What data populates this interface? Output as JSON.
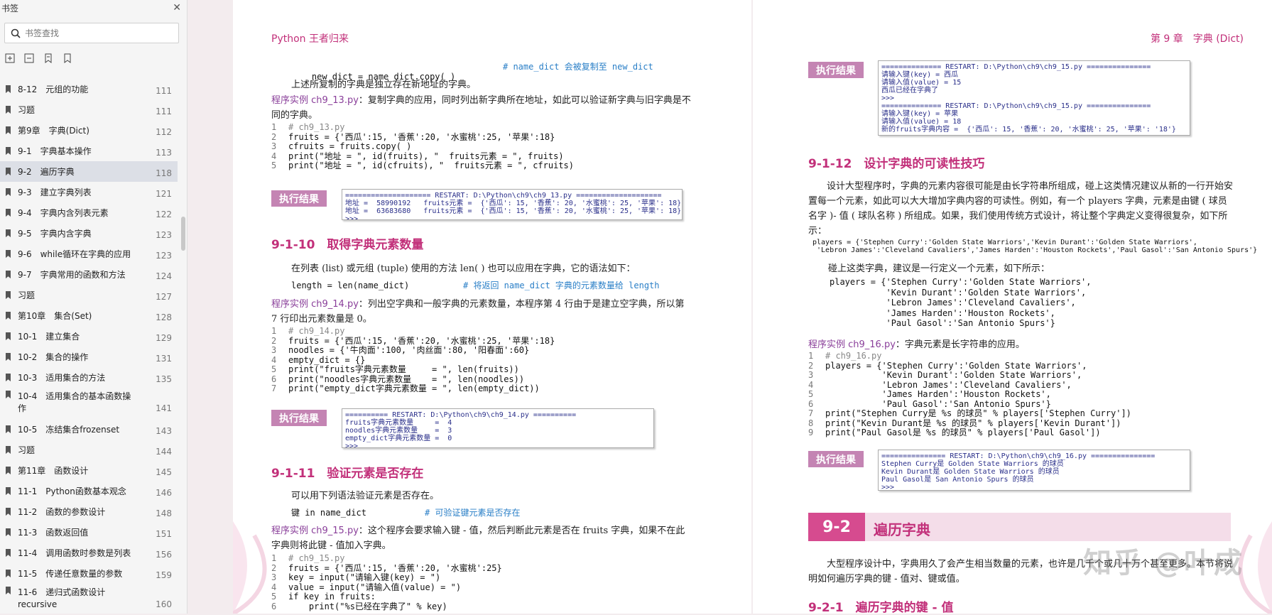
{
  "sidebar": {
    "title": "书签",
    "close_icon": "close-icon",
    "search_placeholder": "书签查找",
    "items": [
      {
        "label": "8-12　元组的功能",
        "page": "111"
      },
      {
        "label": "习题",
        "page": "111"
      },
      {
        "label": "第9章　字典(Dict)",
        "page": "112"
      },
      {
        "label": "9-1　字典基本操作",
        "page": "113"
      },
      {
        "label": "9-2　遍历字典",
        "page": "118"
      },
      {
        "label": "9-3　建立字典列表",
        "page": "121"
      },
      {
        "label": "9-4　字典内含列表元素",
        "page": "122"
      },
      {
        "label": "9-5　字典内含字典",
        "page": "123"
      },
      {
        "label": "9-6　while循环在字典的应用",
        "page": "123"
      },
      {
        "label": "9-7　字典常用的函数和方法",
        "page": "124"
      },
      {
        "label": "习题",
        "page": "127"
      },
      {
        "label": "第10章　集合(Set)",
        "page": "128"
      },
      {
        "label": "10-1　建立集合",
        "page": "129"
      },
      {
        "label": "10-2　集合的操作",
        "page": "131"
      },
      {
        "label": "10-3　适用集合的方法",
        "page": "135"
      },
      {
        "label": "10-4　适用集合的基本函数操作",
        "page": "141"
      },
      {
        "label": "10-5　冻结集合frozenset",
        "page": "143"
      },
      {
        "label": "习题",
        "page": "144"
      },
      {
        "label": "第11章　函数设计",
        "page": "145"
      },
      {
        "label": "11-1　Python函数基本观念",
        "page": "146"
      },
      {
        "label": "11-2　函数的参数设计",
        "page": "148"
      },
      {
        "label": "11-3　函数返回值",
        "page": "151"
      },
      {
        "label": "11-4　调用函数时参数是列表",
        "page": "156"
      },
      {
        "label": "11-5　传递任意数量的参数",
        "page": "159"
      },
      {
        "label": "11-6　递归式函数设计recursive",
        "page": "160"
      }
    ]
  },
  "left": {
    "runhead": "Python 王者归来",
    "copy_line": "new_dict = name_dict.copy( )",
    "copy_comment": "# name_dict 会被复制至 new_dict",
    "p1": "上述所复制的字典是独立存在新地址的字典。",
    "ex13_label": "程序实例 ch9_13.py",
    "ex13_text": "：复制字典的应用，同时列出新字典所在地址，如此可以验证新字典与旧字典是不同的字典。",
    "ex13_code": [
      "# ch9_13.py",
      "fruits = {'西瓜':15, '香蕉':20, '水蜜桃':25, '苹果':18}",
      "cfruits = fruits.copy( )",
      "print(\"地址 = \", id(fruits), \"  fruits元素 = \", fruits)",
      "print(\"地址 = \", id(cfruits), \"  fruits元素 = \", cfruits)"
    ],
    "result_label": "执行结果",
    "ex13_out": "==================== RESTART: D:\\Python\\ch9\\ch9_13.py ====================\n地址 =  58990192   fruits元素 =  {'西瓜': 15, '香蕉': 20, '水蜜桃': 25, '苹果': 18}\n地址 =  63683680   fruits元素 =  {'西瓜': 15, '香蕉': 20, '水蜜桃': 25, '苹果': 18}\n>>>",
    "h_910": "9-1-10　取得字典元素数量",
    "p_len": "在列表 (list) 或元组 (tuple) 使用的方法 len( ) 也可以应用在字典，它的语法如下：",
    "len_line": "length = len(name_dict)",
    "len_comment": "# 将返回 name_dict 字典的元素数量给 length",
    "ex14_label": "程序实例 ch9_14.py",
    "ex14_text": "：列出空字典和一般字典的元素数量，本程序第 4 行由于是建立空字典，所以第 7 行印出元素数量是 0。",
    "ex14_code": [
      "# ch9_14.py",
      "fruits = {'西瓜':15, '香蕉':20, '水蜜桃':25, '苹果':18}",
      "noodles = {'牛肉面':100, '肉丝面':80, '阳春面':60}",
      "empty_dict = {}",
      "print(\"fruits字典元素数量     = \", len(fruits))",
      "print(\"noodles字典元素数量    = \", len(noodles))",
      "print(\"empty_dict字典元素数量 = \", len(empty_dict))"
    ],
    "ex14_out": "========== RESTART: D:\\Python\\ch9\\ch9_14.py ==========\nfruits字典元素数量     =  4\nnoodles字典元素数量    =  3\nempty_dict字典元素数量 =  0\n>>>",
    "h_911": "9-1-11　验证元素是否存在",
    "p_in": "可以用下列语法验证元素是否存在。",
    "in_line": "键 in name_dict",
    "in_comment": "# 可验证键元素是否存在",
    "ex15_label": "程序实例 ch9_15.py",
    "ex15_text": "：这个程序会要求输入键 - 值，然后判断此元素是否在 fruits 字典，如果不在此字典则将此键 - 值加入字典。",
    "ex15_code": [
      "# ch9_15.py",
      "fruits = {'西瓜':15, '香蕉':20, '水蜜桃':25}",
      "key = input(\"请输入键(key) = \")",
      "value = input(\"请输入值(value) = \")",
      "if key in fruits:",
      "    print(\"%s已经在字典了\" % key)"
    ]
  },
  "right": {
    "runhead": "第 9 章　字典 (Dict)",
    "result_label": "执行结果",
    "ex15_out": "============== RESTART: D:\\Python\\ch9\\ch9_15.py ===============\n请输入键(key) = 西瓜\n请输入值(value) = 15\n西瓜已经在字典了\n>>>\n============== RESTART: D:\\Python\\ch9\\ch9_15.py ===============\n请输入键(key) = 苹果\n请输入值(value) = 18\n新的fruits字典内容 =  {'西瓜': 15, '香蕉': 20, '水蜜桃': 25, '苹果': '18'}\n>>>",
    "h_912": "9-1-12　设计字典的可读性技巧",
    "p_912": "设计大型程序时，字典的元素内容很可能是由长字符串所组成，碰上这类情况建议从新的一行开始安置每一个元素，如此可以大大增加字典内容的可读性。例如，有一个 players 字典，元素是由键 ( 球员名字 )- 值 ( 球队名称 ) 所组成。如果，我们使用传统方式设计，将让整个字典定义变得很复杂，如下所示：",
    "players_long": "players = {'Stephen Curry':'Golden State Warriors','Kevin Durant':'Golden State Warriors',\n 'Lebron James':'Cleveland Cavaliers','James Harden':'Houston Rockets','Paul Gasol':'San Antonio Spurs'}",
    "p_multi": "碰上这类字典，建议是一行定义一个元素，如下所示：",
    "players_multi": "players = {'Stephen Curry':'Golden State Warriors',\n           'Kevin Durant':'Golden State Warriors',\n           'Lebron James':'Cleveland Cavaliers',\n           'James Harden':'Houston Rockets',\n           'Paul Gasol':'San Antonio Spurs'}",
    "ex16_label": "程序实例 ch9_16.py",
    "ex16_text": "：字典元素是长字符串的应用。",
    "ex16_code": [
      "# ch9_16.py",
      "players = {'Stephen Curry':'Golden State Warriors',",
      "           'Kevin Durant':'Golden State Warriors',",
      "           'Lebron James':'Cleveland Cavaliers',",
      "           'James Harden':'Houston Rockets',",
      "           'Paul Gasol':'San Antonio Spurs'}",
      "print(\"Stephen Curry是 %s 的球员\" % players['Stephen Curry'])",
      "print(\"Kevin Durant是 %s 的球员\" % players['Kevin Durant'])",
      "print(\"Paul Gasol是 %s 的球员\" % players['Paul Gasol'])"
    ],
    "ex16_out": "=============== RESTART: D:\\Python\\ch9\\ch9_16.py ===============\nStephen Curry是 Golden State Warriors 的球员\nKevin Durant是 Golden State Warriors 的球员\nPaul Gasol是 San Antonio Spurs 的球员\n>>>",
    "sec_num": "9-2",
    "sec_title": "遍历字典",
    "p_92": "大型程序设计中，字典用久了会产生相当数量的元素，也许是几千个或几十万个甚至更多。本节将说明如何遍历字典的键 - 值对、键或值。",
    "h_921": "9-2-1　遍历字典的键 - 值",
    "watermark": "知乎 @叶成"
  }
}
